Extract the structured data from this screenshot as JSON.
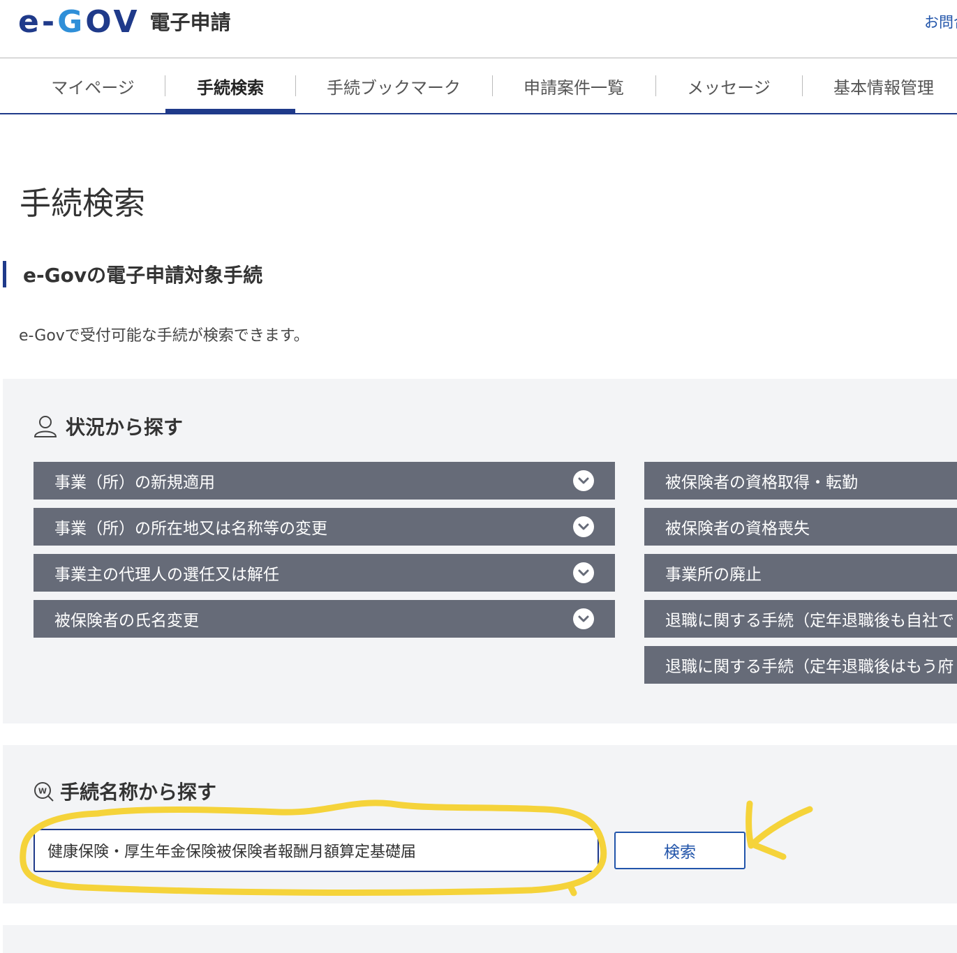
{
  "header": {
    "logo_mark": "e-GOV",
    "app_name": "電子申請",
    "contact_link": "お問合"
  },
  "nav": {
    "items": [
      {
        "label": "マイページ"
      },
      {
        "label": "手続検索"
      },
      {
        "label": "手続ブックマーク"
      },
      {
        "label": "申請案件一覧"
      },
      {
        "label": "メッセージ"
      },
      {
        "label": "基本情報管理"
      }
    ],
    "active_index": 1
  },
  "page": {
    "title": "手続検索",
    "section_title": "e-Govの電子申請対象手続",
    "lead": "e-Govで受付可能な手続が検索できます。"
  },
  "situation": {
    "heading": "状況から探す",
    "icon": "user-icon",
    "left_items": [
      {
        "label": "事業（所）の新規適用"
      },
      {
        "label": "事業（所）の所在地又は名称等の変更"
      },
      {
        "label": "事業主の代理人の選任又は解任"
      },
      {
        "label": "被保険者の氏名変更"
      }
    ],
    "right_items": [
      {
        "label": "被保険者の資格取得・転勤"
      },
      {
        "label": "被保険者の資格喪失"
      },
      {
        "label": "事業所の廃止"
      },
      {
        "label": "退職に関する手続（定年退職後も自社で"
      },
      {
        "label": "退職に関する手続（定年退職後はもう府"
      }
    ]
  },
  "name_search": {
    "heading": "手続名称から探す",
    "icon": "word-search-icon",
    "input_value": "健康保険・厚生年金保険被保険者報酬月額算定基礎届",
    "button_label": "検索"
  },
  "colors": {
    "brand": "#1f3a8a",
    "bar": "#666b78",
    "panel": "#f3f4f6",
    "annotation": "#f5d33a"
  }
}
